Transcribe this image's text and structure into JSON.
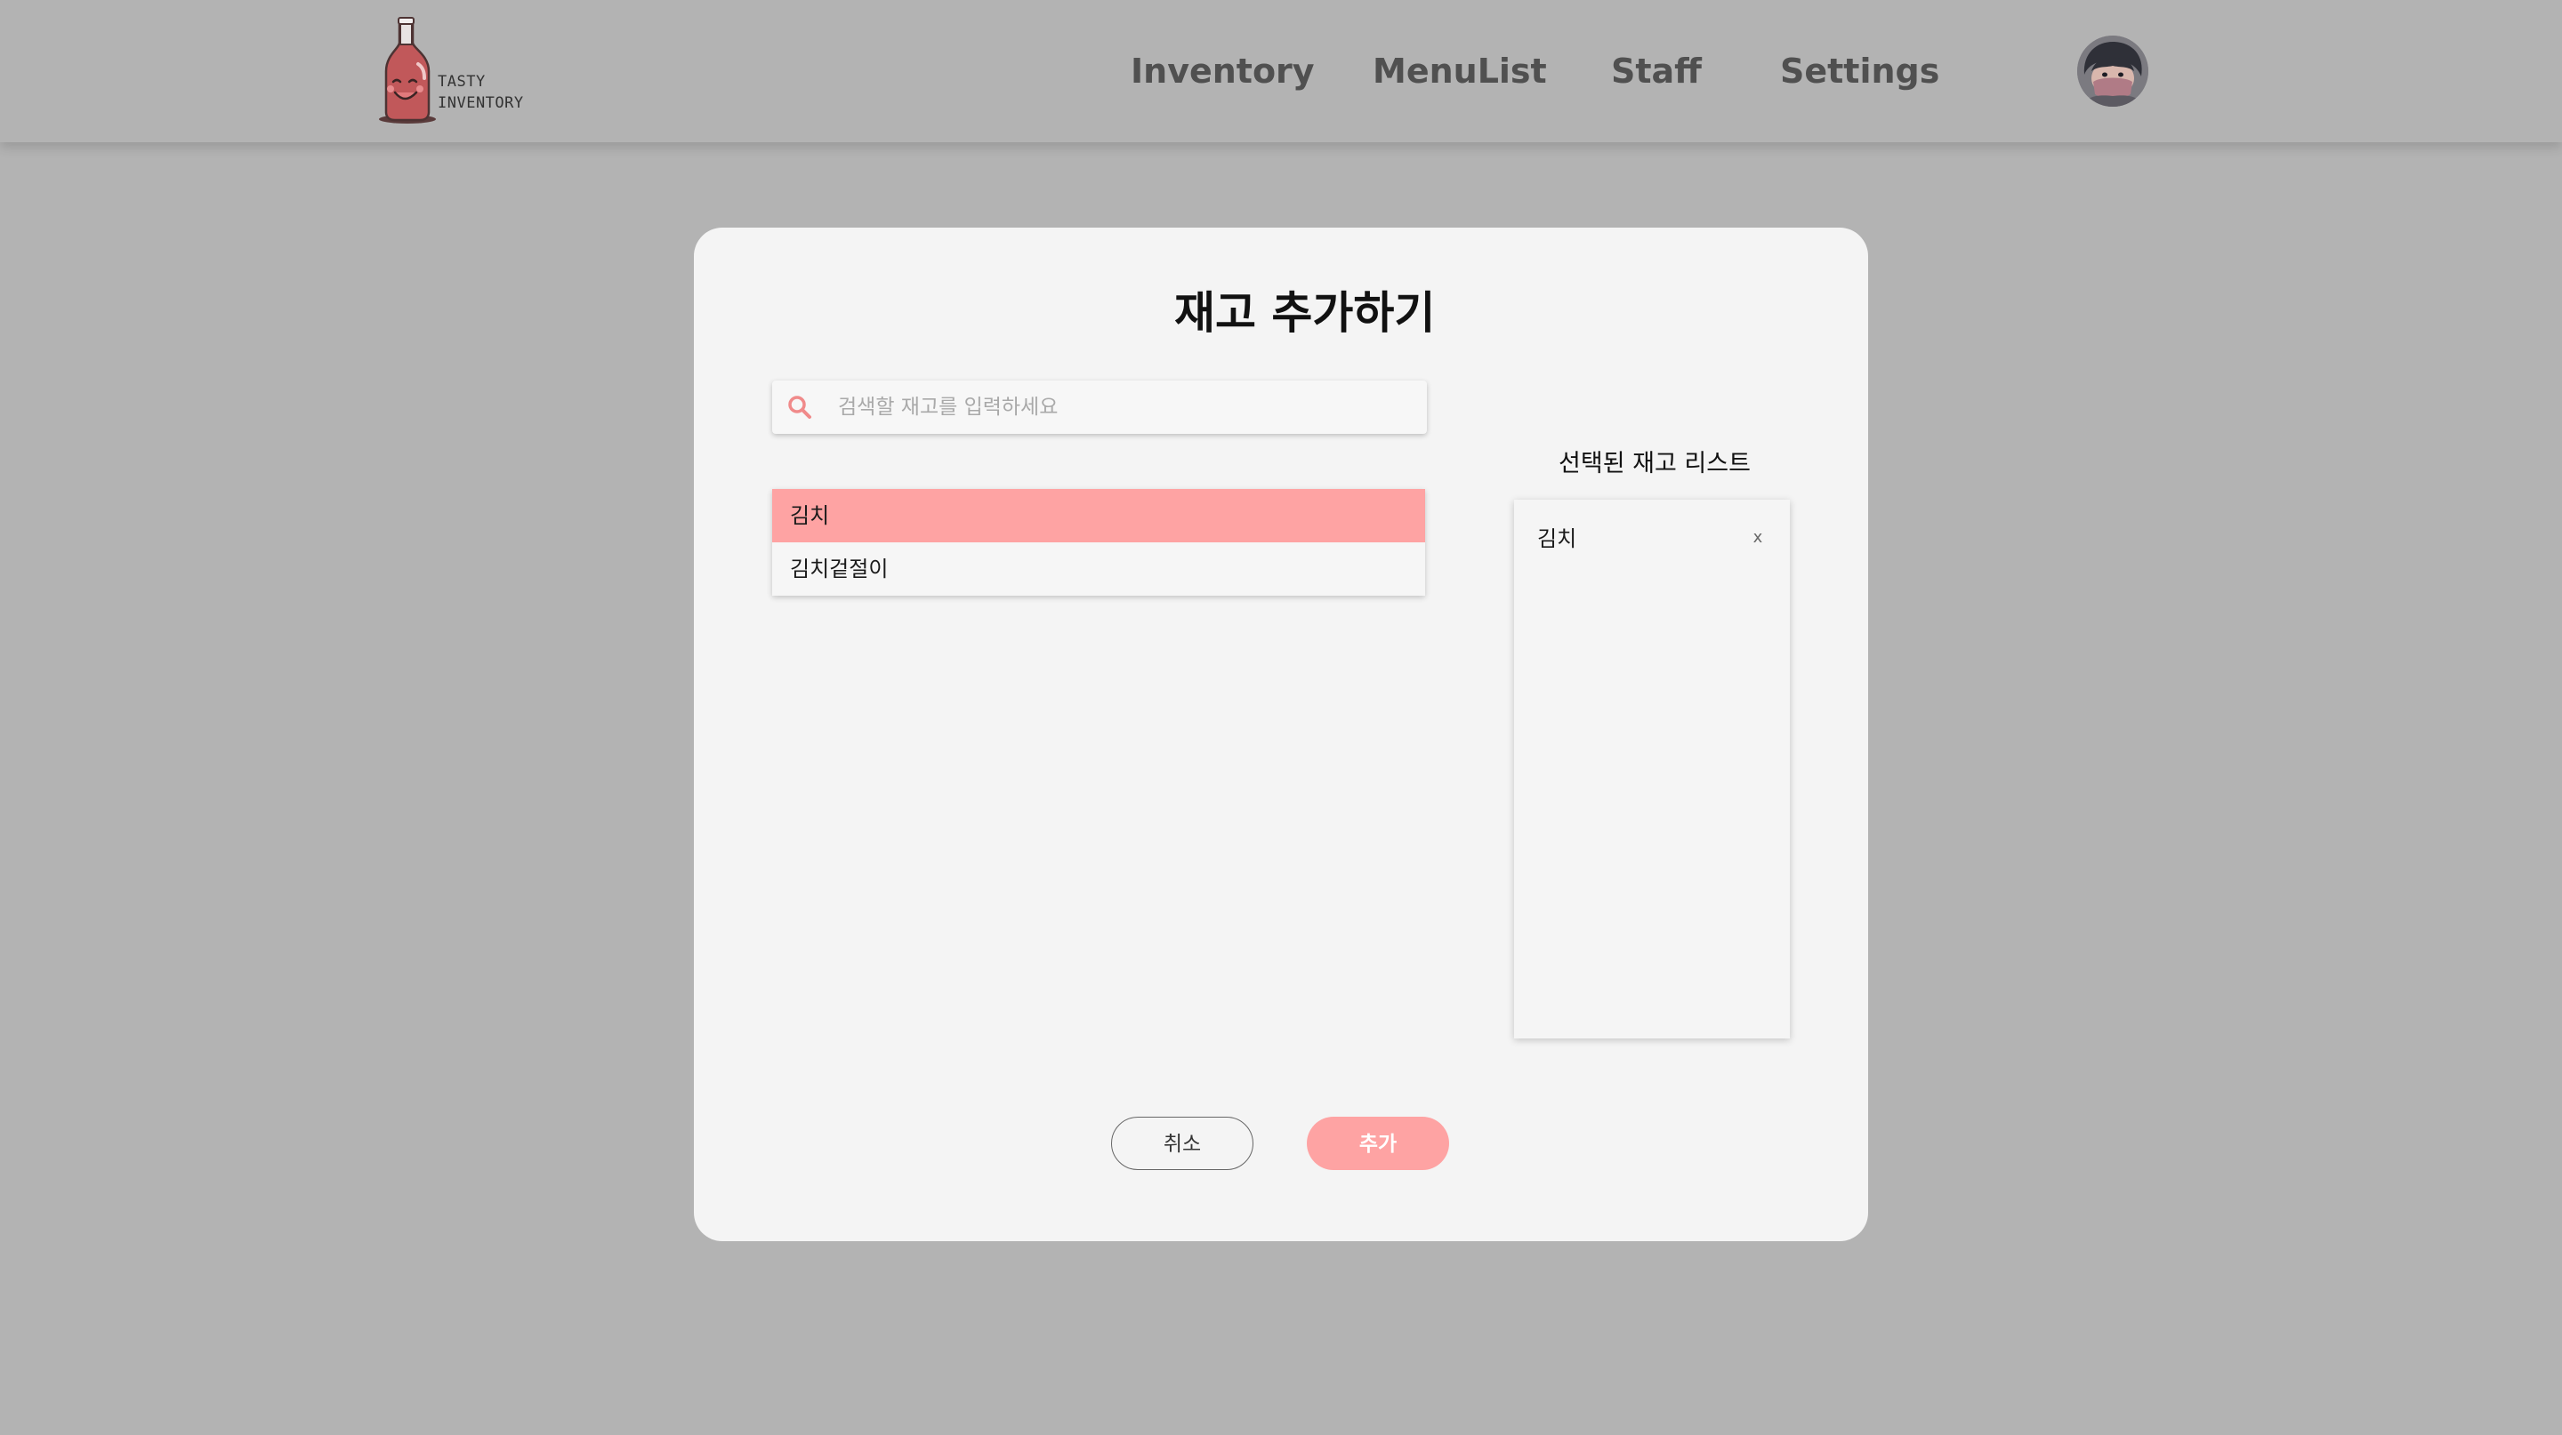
{
  "colors": {
    "overlay_background": "#b3b3b3",
    "modal_background": "#f4f4f4",
    "accent": "#fea3a3",
    "nav_text": "#505050"
  },
  "header": {
    "logo": {
      "icon": "bottle-mascot-icon",
      "line1": "TASTY",
      "line2": "INVENTORY"
    },
    "nav": {
      "inventory": "Inventory",
      "menulist": "MenuList",
      "staff": "Staff",
      "settings": "Settings"
    },
    "avatar_icon": "user-avatar"
  },
  "modal": {
    "title": "재고 추가하기",
    "search": {
      "icon": "search-icon",
      "placeholder": "검색할 재고를 입력하세요",
      "value": ""
    },
    "results": [
      {
        "label": "김치",
        "highlighted": true
      },
      {
        "label": "김치겉절이",
        "highlighted": false
      }
    ],
    "selected": {
      "title": "선택된 재고 리스트",
      "items": [
        {
          "label": "김치",
          "remove_label": "x"
        }
      ]
    },
    "buttons": {
      "cancel": "취소",
      "add": "추가"
    }
  }
}
